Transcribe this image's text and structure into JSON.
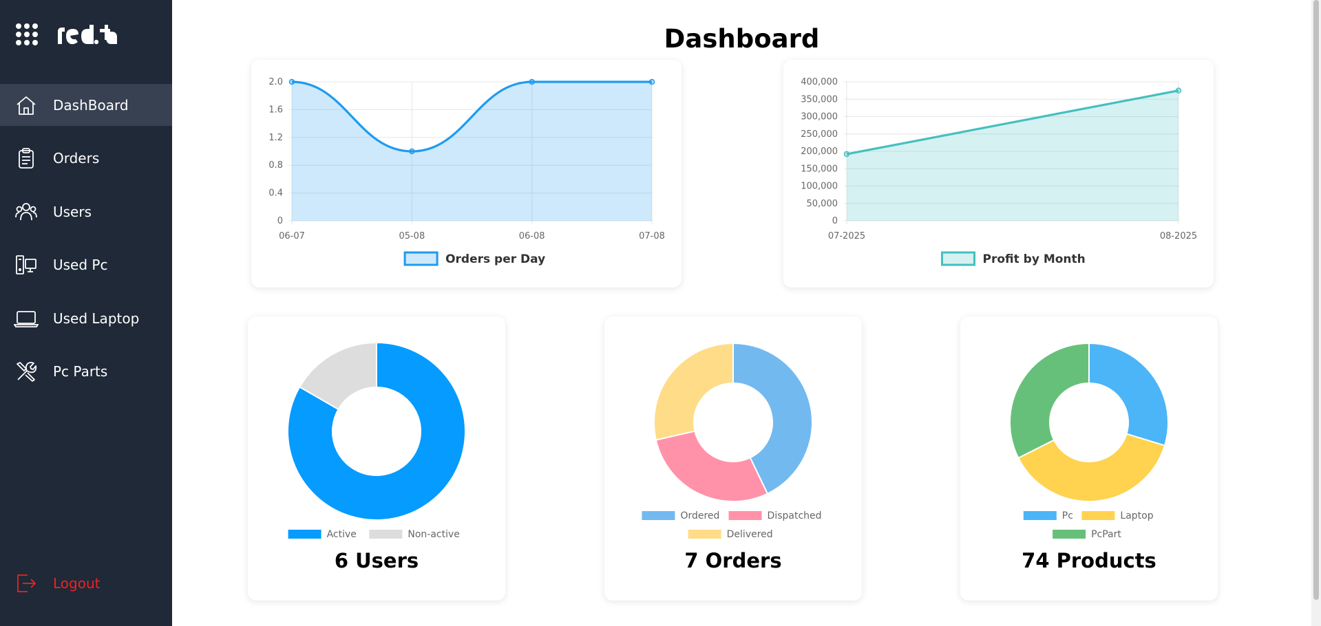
{
  "app": {
    "logo_text": "red.tag"
  },
  "sidebar": {
    "items": [
      {
        "label": "DashBoard",
        "icon": "home-icon",
        "active": true
      },
      {
        "label": "Orders",
        "icon": "clipboard-icon"
      },
      {
        "label": "Users",
        "icon": "users-icon"
      },
      {
        "label": "Used Pc",
        "icon": "desktop-pc-icon"
      },
      {
        "label": "Used Laptop",
        "icon": "laptop-icon"
      },
      {
        "label": "Pc Parts",
        "icon": "tools-icon"
      }
    ],
    "logout_label": "Logout"
  },
  "page": {
    "title": "Dashboard"
  },
  "colors": {
    "sidebar_bg": "#1f2937",
    "active_item_bg": "#374151",
    "logout_red": "#ef2222",
    "orders_line": "#1e9bef",
    "profit_line": "#45bfbf"
  },
  "cards": {
    "users": {
      "count_label": "6 Users"
    },
    "orders": {
      "count_label": "7 Orders"
    },
    "products": {
      "count_label": "74 Products"
    }
  },
  "chart_data": [
    {
      "type": "line",
      "categories": [
        "06-07",
        "05-08",
        "06-08",
        "07-08"
      ],
      "series": [
        {
          "name": "Orders per Day",
          "values": [
            2,
            1,
            2,
            2
          ],
          "color": "#1e9bef"
        }
      ],
      "ylim": [
        0,
        2
      ],
      "yticks": [
        "0",
        "0.4",
        "0.8",
        "1.2",
        "1.6",
        "2.0"
      ],
      "fill": true,
      "legend": "bottom"
    },
    {
      "type": "line",
      "categories": [
        "07-2025",
        "08-2025"
      ],
      "series": [
        {
          "name": "Profit by Month",
          "values": [
            192000,
            375000
          ],
          "color": "#45bfbf"
        }
      ],
      "ylim": [
        0,
        400000
      ],
      "yticks": [
        "0",
        "50,000",
        "100,000",
        "150,000",
        "200,000",
        "250,000",
        "300,000",
        "350,000",
        "400,000"
      ],
      "fill": true,
      "legend": "bottom"
    },
    {
      "type": "pie",
      "donut": true,
      "labels": [
        "Active",
        "Non-active"
      ],
      "values": [
        5,
        1
      ],
      "colors": [
        "#059bff",
        "#dddddd"
      ]
    },
    {
      "type": "pie",
      "donut": true,
      "labels": [
        "Ordered",
        "Dispatched",
        "Delivered"
      ],
      "values": [
        3,
        2,
        2
      ],
      "colors": [
        "#72b9f0",
        "#ff92a9",
        "#ffdc88"
      ]
    },
    {
      "type": "pie",
      "donut": true,
      "labels": [
        "Pc",
        "Laptop",
        "PcPart"
      ],
      "values": [
        22,
        28,
        24
      ],
      "colors": [
        "#4bb5f8",
        "#ffd24f",
        "#67c07a"
      ]
    }
  ]
}
